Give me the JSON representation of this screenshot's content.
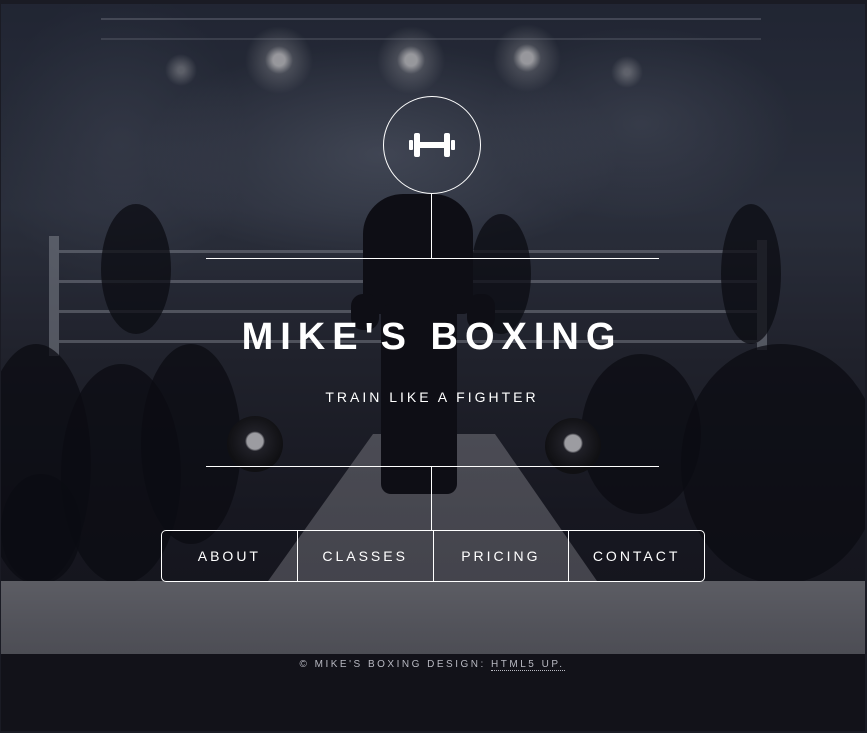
{
  "logo": {
    "icon": "dumbbell-icon"
  },
  "header": {
    "title": "MIKE'S BOXING",
    "tagline": "TRAIN LIKE A FIGHTER"
  },
  "nav": {
    "items": [
      {
        "label": "ABOUT"
      },
      {
        "label": "CLASSES"
      },
      {
        "label": "PRICING"
      },
      {
        "label": "CONTACT"
      }
    ]
  },
  "footer": {
    "copyright": "© MIKE'S BOXING",
    "design_label": "DESIGN:",
    "design_link": "HTML5 UP."
  },
  "colors": {
    "text": "#ffffff",
    "footer_text": "#b8b9c2"
  }
}
